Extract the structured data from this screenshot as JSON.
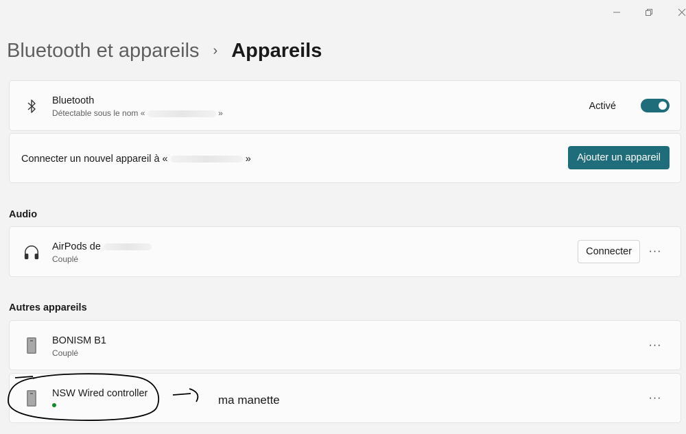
{
  "window": {
    "minimize_icon": "minimize-icon",
    "restore_icon": "restore-icon",
    "close_icon": "close-icon"
  },
  "breadcrumb": {
    "parent": "Bluetooth et appareils",
    "separator": "›",
    "current": "Appareils"
  },
  "bluetooth": {
    "icon": "bluetooth-icon",
    "title": "Bluetooth",
    "subtitle_prefix": "Détectable sous le nom «",
    "subtitle_suffix": "»",
    "toggle_label": "Activé",
    "toggle_on": true
  },
  "add_device": {
    "label_prefix": "Connecter un nouvel appareil à «",
    "label_suffix": "»",
    "button": "Ajouter un appareil"
  },
  "audio": {
    "heading": "Audio",
    "devices": [
      {
        "icon": "headphones-icon",
        "name": "AirPods de",
        "status": "Couplé",
        "action": "Connecter",
        "more": "···"
      }
    ]
  },
  "other": {
    "heading": "Autres appareils",
    "devices": [
      {
        "icon": "device-icon",
        "name": "BONISM B1",
        "status": "Couplé",
        "more": "···"
      },
      {
        "icon": "device-icon",
        "name": "NSW Wired controller",
        "status": "",
        "connected": true,
        "more": "···"
      }
    ]
  },
  "annotation": {
    "text": "ma manette"
  },
  "colors": {
    "accent": "#1f6d7a",
    "background": "#f3f3f3",
    "card": "#fbfbfb",
    "connected_dot": "#108a2c"
  }
}
